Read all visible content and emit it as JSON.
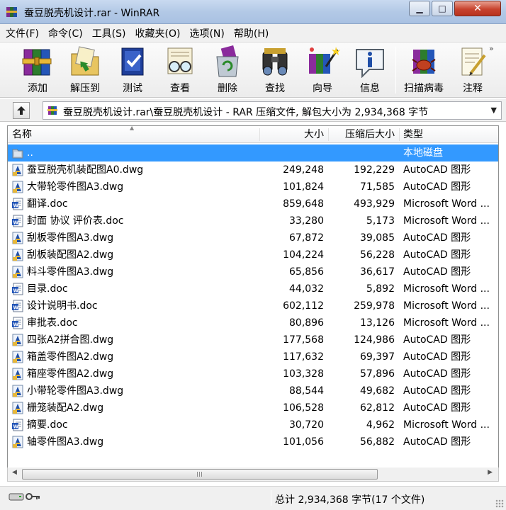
{
  "window": {
    "title": "蚕豆脱壳机设计.rar - WinRAR",
    "minimize_glyph": "▁",
    "maximize_glyph": "□",
    "close_glyph": "✕"
  },
  "menu": [
    "文件(F)",
    "命令(C)",
    "工具(S)",
    "收藏夹(O)",
    "选项(N)",
    "帮助(H)"
  ],
  "toolbar": [
    {
      "label": "添加",
      "icon": "winrar-books-icon"
    },
    {
      "label": "解压到",
      "icon": "extract-folder-icon"
    },
    {
      "label": "测试",
      "icon": "test-book-icon"
    },
    {
      "label": "查看",
      "icon": "view-glasses-icon"
    },
    {
      "label": "删除",
      "icon": "delete-recycle-icon"
    },
    {
      "label": "查找",
      "icon": "find-binoculars-icon"
    },
    {
      "label": "向导",
      "icon": "wizard-icon"
    },
    {
      "label": "信息",
      "icon": "info-icon"
    },
    {
      "label": "扫描病毒",
      "icon": "scan-virus-icon"
    },
    {
      "label": "注释",
      "icon": "comment-icon"
    }
  ],
  "toolbar_more": "»",
  "address": {
    "path": "蚕豆脱壳机设计.rar\\蚕豆脱壳机设计 - RAR 压缩文件, 解包大小为 2,934,368 字节",
    "dropdown_glyph": "▼"
  },
  "columns": {
    "name": "名称",
    "size": "大小",
    "packed": "压缩后大小",
    "type": "类型",
    "sort_glyph": "▲"
  },
  "rows": [
    {
      "name": "..",
      "size": "",
      "packed": "",
      "type": "本地磁盘",
      "kind": "up",
      "selected": true
    },
    {
      "name": "蚕豆脱壳机装配图A0.dwg",
      "size": "249,248",
      "packed": "192,229",
      "type": "AutoCAD 图形",
      "kind": "dwg"
    },
    {
      "name": "大带轮零件图A3.dwg",
      "size": "101,824",
      "packed": "71,585",
      "type": "AutoCAD 图形",
      "kind": "dwg"
    },
    {
      "name": "翻译.doc",
      "size": "859,648",
      "packed": "493,929",
      "type": "Microsoft Word ...",
      "kind": "doc"
    },
    {
      "name": "封面 协议 评价表.doc",
      "size": "33,280",
      "packed": "5,173",
      "type": "Microsoft Word ...",
      "kind": "doc"
    },
    {
      "name": "刮板零件图A3.dwg",
      "size": "67,872",
      "packed": "39,085",
      "type": "AutoCAD 图形",
      "kind": "dwg"
    },
    {
      "name": "刮板装配图A2.dwg",
      "size": "104,224",
      "packed": "56,228",
      "type": "AutoCAD 图形",
      "kind": "dwg"
    },
    {
      "name": "料斗零件图A3.dwg",
      "size": "65,856",
      "packed": "36,617",
      "type": "AutoCAD 图形",
      "kind": "dwg"
    },
    {
      "name": "目录.doc",
      "size": "44,032",
      "packed": "5,892",
      "type": "Microsoft Word ...",
      "kind": "doc"
    },
    {
      "name": "设计说明书.doc",
      "size": "602,112",
      "packed": "259,978",
      "type": "Microsoft Word ...",
      "kind": "doc"
    },
    {
      "name": "审批表.doc",
      "size": "80,896",
      "packed": "13,126",
      "type": "Microsoft Word ...",
      "kind": "doc"
    },
    {
      "name": "四张A2拼合图.dwg",
      "size": "177,568",
      "packed": "124,986",
      "type": "AutoCAD 图形",
      "kind": "dwg"
    },
    {
      "name": "箱盖零件图A2.dwg",
      "size": "117,632",
      "packed": "69,397",
      "type": "AutoCAD 图形",
      "kind": "dwg"
    },
    {
      "name": "箱座零件图A2.dwg",
      "size": "103,328",
      "packed": "57,896",
      "type": "AutoCAD 图形",
      "kind": "dwg"
    },
    {
      "name": "小带轮零件图A3.dwg",
      "size": "88,544",
      "packed": "49,682",
      "type": "AutoCAD 图形",
      "kind": "dwg"
    },
    {
      "name": "栅笼装配A2.dwg",
      "size": "106,528",
      "packed": "62,812",
      "type": "AutoCAD 图形",
      "kind": "dwg"
    },
    {
      "name": "摘要.doc",
      "size": "30,720",
      "packed": "4,962",
      "type": "Microsoft Word ...",
      "kind": "doc"
    },
    {
      "name": "轴零件图A3.dwg",
      "size": "101,056",
      "packed": "56,882",
      "type": "AutoCAD 图形",
      "kind": "dwg"
    }
  ],
  "scrollbar": {
    "left_glyph": "◀",
    "right_glyph": "▶"
  },
  "status": {
    "text": "总计 2,934,368 字节(17 个文件)"
  },
  "colors": {
    "selection": "#3399ff",
    "title_gradient_top": "#c9daf0",
    "close_button": "#c7432e"
  }
}
